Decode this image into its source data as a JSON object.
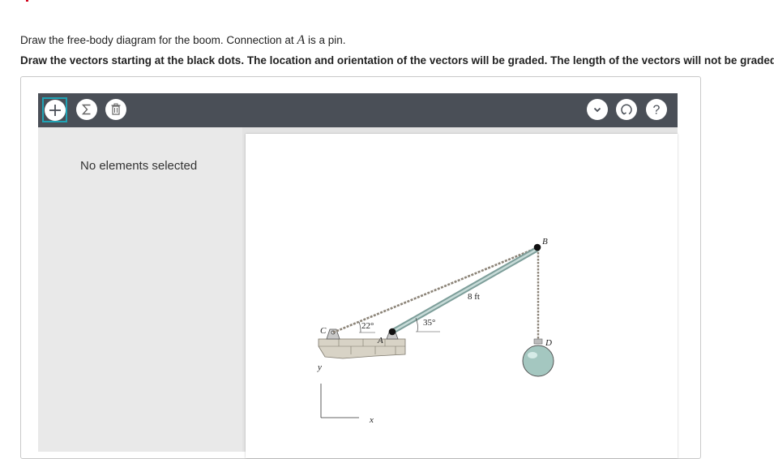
{
  "question": {
    "line1_prefix": "Draw the free-body diagram for the boom. Connection at ",
    "line1_var": "A",
    "line1_suffix": " is a pin.",
    "line2": "Draw the vectors starting at the black dots. The location and orientation of the vectors will be graded. The length of the vectors will not be graded."
  },
  "toolbar": {
    "left_buttons": [
      {
        "icon": "plus-icon",
        "selected": true
      },
      {
        "icon": "sigma-icon"
      },
      {
        "icon": "trash-icon"
      }
    ],
    "right_buttons": [
      {
        "icon": "chevron-down-icon"
      },
      {
        "icon": "reset-icon"
      },
      {
        "icon": "help-icon"
      }
    ],
    "accent_color": "#1fa3b5",
    "bar_color": "#4a4f57"
  },
  "panel": {
    "status_text": "No elements selected"
  },
  "diagram": {
    "labels": {
      "point_b": "B",
      "point_c": "C",
      "point_a": "A",
      "point_d": "D",
      "length": "8 ft",
      "angle_cable": "22°",
      "angle_boom": "35°",
      "axis_y": "y",
      "axis_x": "x"
    }
  }
}
